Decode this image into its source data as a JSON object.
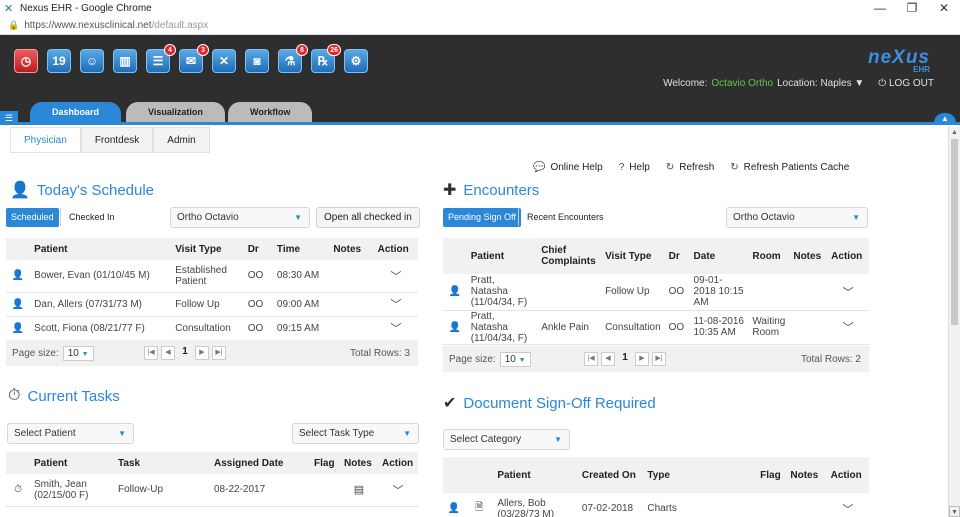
{
  "browser": {
    "tab_title": "Nexus EHR - Google Chrome",
    "url_host": "https://www.nexusclinical.net",
    "url_path": "/default.aspx"
  },
  "header": {
    "brand": "neXus",
    "brand_sub": "EHR",
    "welcome_label": "Welcome:",
    "user_name": "Octavio Ortho",
    "location_label": "Location: Naples",
    "logout": "LOG OUT",
    "toolbar": [
      {
        "name": "clock-icon",
        "glyph": "◷",
        "badge": "",
        "red": true
      },
      {
        "name": "calendar-icon",
        "glyph": "19",
        "badge": "",
        "red": false
      },
      {
        "name": "patients-icon",
        "glyph": "☺",
        "badge": "",
        "red": false
      },
      {
        "name": "reports-icon",
        "glyph": "▥",
        "badge": "",
        "red": false
      },
      {
        "name": "tasks-icon",
        "glyph": "☰",
        "badge": "4",
        "red": false
      },
      {
        "name": "messages-icon",
        "glyph": "✉",
        "badge": "3",
        "red": false
      },
      {
        "name": "tools-icon",
        "glyph": "✕",
        "badge": "",
        "red": false
      },
      {
        "name": "camera-icon",
        "glyph": "◙",
        "badge": "",
        "red": false
      },
      {
        "name": "lab-icon",
        "glyph": "⚗",
        "badge": "8",
        "red": false
      },
      {
        "name": "rx-icon",
        "glyph": "℞",
        "badge": "26",
        "red": false
      },
      {
        "name": "settings-icon",
        "glyph": "⚙",
        "badge": "",
        "red": false
      }
    ]
  },
  "main_tabs": [
    "Dashboard",
    "Visualization",
    "Workflow"
  ],
  "sub_tabs": [
    "Physician",
    "Frontdesk",
    "Admin"
  ],
  "help_bar": {
    "online_help": "Online Help",
    "help": "Help",
    "refresh": "Refresh",
    "refresh_cache": "Refresh Patients Cache"
  },
  "schedule": {
    "title": "Today's Schedule",
    "tab_scheduled": "Scheduled",
    "tab_checked_in": "Checked In",
    "provider": "Ortho Octavio",
    "open_all": "Open all checked in",
    "columns": [
      "Patient",
      "Visit Type",
      "Dr",
      "Time",
      "Notes",
      "Action"
    ],
    "rows": [
      {
        "patient": "Bower, Evan (01/10/45 M)",
        "visit": "Established Patient",
        "dr": "OO",
        "time": "08:30 AM"
      },
      {
        "patient": "Dan, Allers (07/31/73 M)",
        "visit": "Follow Up",
        "dr": "OO",
        "time": "09:00 AM"
      },
      {
        "patient": "Scott, Fiona (08/21/77 F)",
        "visit": "Consultation",
        "dr": "OO",
        "time": "09:15 AM"
      }
    ],
    "page_size_label": "Page size:",
    "page_size": "10",
    "page": "1",
    "total": "Total Rows: 3"
  },
  "encounters": {
    "title": "Encounters",
    "tab_pending": "Pending Sign Off",
    "tab_recent": "Recent Encounters",
    "provider": "Ortho Octavio",
    "columns": [
      "Patient",
      "Chief Complaints",
      "Visit Type",
      "Dr",
      "Date",
      "Room",
      "Notes",
      "Action"
    ],
    "rows": [
      {
        "patient": "Pratt, Natasha (11/04/34, F)",
        "complaint": "",
        "visit": "Follow Up",
        "dr": "OO",
        "date": "09-01-2018 10:15 AM",
        "room": ""
      },
      {
        "patient": "Pratt, Natasha (11/04/34, F)",
        "complaint": "Ankle Pain",
        "visit": "Consultation",
        "dr": "OO",
        "date": "11-08-2016 10:35 AM",
        "room": "Waiting Room"
      }
    ],
    "page_size_label": "Page size:",
    "page_size": "10",
    "page": "1",
    "total": "Total Rows: 2"
  },
  "tasks": {
    "title": "Current Tasks",
    "select_patient": "Select Patient",
    "select_task_type": "Select Task Type",
    "columns": [
      "Patient",
      "Task",
      "Assigned Date",
      "Flag",
      "Notes",
      "Action"
    ],
    "rows": [
      {
        "patient": "Smith, Jean (02/15/00 F)",
        "task": "Follow-Up",
        "date": "08-22-2017"
      }
    ]
  },
  "documents": {
    "title": "Document Sign-Off Required",
    "select_category": "Select Category",
    "columns": [
      "Patient",
      "Created On",
      "Type",
      "Flag",
      "Notes",
      "Action"
    ],
    "rows": [
      {
        "patient": "Allers, Bob (03/28/73 M)",
        "created": "07-02-2018",
        "type": "Charts"
      }
    ]
  }
}
